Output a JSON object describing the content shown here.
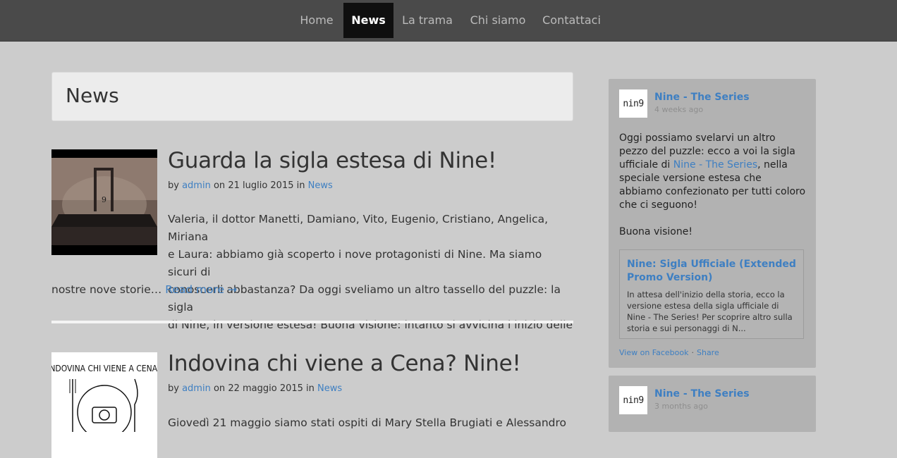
{
  "nav": {
    "items": [
      {
        "label": "Home",
        "active": false
      },
      {
        "label": "News",
        "active": true
      },
      {
        "label": "La trama",
        "active": false
      },
      {
        "label": "Chi siamo",
        "active": false
      },
      {
        "label": "Contattaci",
        "active": false
      }
    ]
  },
  "page": {
    "title": "News"
  },
  "posts": [
    {
      "title": "Guarda la sigla estesa di Nine!",
      "meta_by": "by",
      "author": "admin",
      "meta_on": "on",
      "date": "21 luglio 2015",
      "meta_in": "in",
      "category": "News",
      "excerpt_lines": [
        "Valeria, il dottor Manetti, Damiano, Vito, Eugenio, Cristiano, Angelica, Miriana",
        "e Laura: abbiamo già scoperto i nove protagonisti di Nine. Ma siamo sicuri di",
        "conoscerli abbastanza? Da oggi sveliamo un altro tassello del puzzle: la sigla",
        "di Nine, in versione estesa! Buona visione: intanto si avvicina l’inizio delle"
      ],
      "excerpt_last": "nostre nove storie…",
      "read_more": "Read more →"
    },
    {
      "title": "Indovina chi viene a Cena? Nine!",
      "meta_by": "by",
      "author": "admin",
      "meta_on": "on",
      "date": "22 maggio 2015",
      "meta_in": "in",
      "category": "News",
      "excerpt_first_line": "Giovedì 21 maggio siamo stati ospiti di Mary Stella Brugiati e Alessandro",
      "thumb_text": "INDOVINA CHI VIENE A CENA?"
    }
  ],
  "sidebar": {
    "cards": [
      {
        "logo_text": "nin9",
        "page_name": "Nine - The Series",
        "time": "4 weeks ago",
        "text_before_link": "Oggi possiamo svelarvi un altro pezzo del puzzle: ecco a voi la sigla ufficiale di ",
        "inline_link": "Nine - The Series",
        "text_after_link": ", nella speciale versione estesa che abbiamo confezionato per tutti coloro che ci seguono!",
        "text_second_para": "Buona visione!",
        "link_title": "Nine: Sigla Ufficiale (Extended Promo Version)",
        "link_desc": "In attesa dell'inizio della storia, ecco la versione estesa della sigla ufficiale di Nine - The Series! Per scoprire altro sulla storia e sui personaggi di N...",
        "view_on_facebook": "View on Facebook",
        "dot": "·",
        "share": "Share"
      },
      {
        "logo_text": "nin9",
        "page_name": "Nine - The Series",
        "time": "3 months ago"
      }
    ]
  },
  "colors": {
    "background": "#cccccc",
    "navbar": "#4a4a4a",
    "nav_active": "#0f0f0f",
    "link": "#3e7fc2",
    "sidebar_card": "#b2b2b2"
  }
}
